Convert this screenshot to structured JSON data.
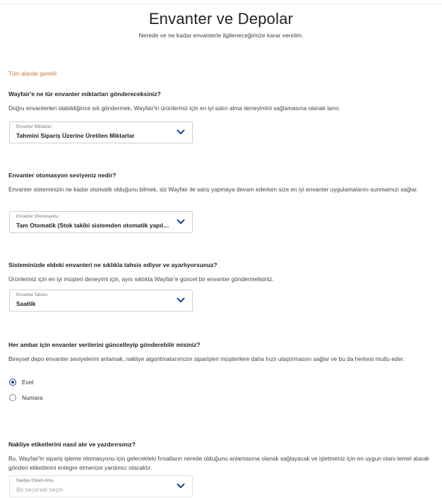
{
  "header": {
    "title": "Envanter ve Depolar",
    "subtitle": "Nerede ve ne kadar envanterle ilgileneceğimize karar verelim."
  },
  "required_note": "Tüm alanlar gerekli",
  "colors": {
    "accent": "#1a3ea0",
    "required": "#c8793a",
    "chevron": "#1a3ea0"
  },
  "sections": [
    {
      "question": "Wayfair'e ne tür envanter miktarları göndereceksiniz?",
      "description": "Doğru envanterleri olabildiğince sık göndermek, Wayfair'in ürünleriniz için en iyi satın alma deneyimini sağlamasına olanak tanır.",
      "select": {
        "label": "Envanter Miktarları",
        "value": "Tahmini Sipariş Üzerine Üretilen Miktarlar",
        "icon": "chevron-down-icon"
      }
    },
    {
      "question": "Envanter otomasyon seviyeniz nedir?",
      "description": "Envanter sisteminizin ne kadar otomatik olduğunu bilmek, siz Wayfair ile satış yapmaya devam ederken size en iyi envanter uygulamalarını sunmamızı sağlar.",
      "select": {
        "label": "Envanter Otomasyonu",
        "value": "Tam Otomatik (Stok takibi sistemden otomatik yapılır...",
        "icon": "chevron-down-icon"
      }
    },
    {
      "question": "Sisteminizde eldeki envanteri ne sıklıkla tahsis ediyor ve ayarlıyorsunuz?",
      "description": "Ürünleriniz için en iyi müşteri deneyimi için, aynı sıklıkta Wayfair'e güncel bir envanter göndermelisiniz.",
      "select": {
        "label": "Envanter Tahsisi",
        "value": "Saatlik",
        "icon": "chevron-down-icon"
      }
    },
    {
      "question": "Her ambar için envanter verilerini güncelleyip gönderebilir misiniz?",
      "description": "Bireysel depo envanter seviyelerini anlamak, nakliye algoritmalarımızın siparişleri müşterilere daha hızlı ulaştırmasını sağlar ve bu da herkesi mutlu eder.",
      "radios": [
        {
          "label": "Evet",
          "selected": true
        },
        {
          "label": "Numara",
          "selected": false
        }
      ]
    },
    {
      "question": "Nakliye etiketlerini nasıl alır ve yazdırırsınız?",
      "description": "Bu, Wayfair'in sipariş işleme otomasyonu için gelecekteki fırsatların nerede olduğunu anlamasına olanak sağlayacak ve işletmeniz için en uygun olanı temel alarak gönderi etiketlerini entegre etmenize yardımcı olacaktır.",
      "select": {
        "label": "Nakliye Etiketi Alma",
        "placeholder": "Bir seçenek seçin",
        "icon": "chevron-down-icon"
      }
    }
  ]
}
